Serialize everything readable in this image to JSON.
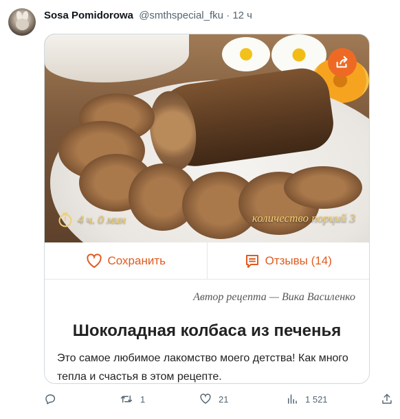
{
  "tweet": {
    "author_name": "Sosa Pomidorowa",
    "handle": "@smthspecial_fku",
    "separator": "·",
    "time": "12 ч",
    "more": "···"
  },
  "recipe": {
    "cook_time": "4 ч. 0 мин",
    "servings": "количество порций 3",
    "save_label": "Сохранить",
    "reviews_label": "Отзывы (14)",
    "author_line": "Автор рецепта — Вика Василенко",
    "title": "Шоколадная колбаса из печенья",
    "description": "Это самое любимое лакомство моего детства! Как много тепла и счастья в этом рецепте.",
    "accent": "#ee6a24"
  },
  "stats": {
    "replies": "",
    "retweets": "1",
    "likes": "21",
    "views": "1 521"
  },
  "icons": [
    "reply-icon",
    "retweet-icon",
    "like-icon",
    "views-icon",
    "share-icon",
    "heart-icon",
    "comments-icon",
    "timer-icon",
    "external-share-icon"
  ]
}
